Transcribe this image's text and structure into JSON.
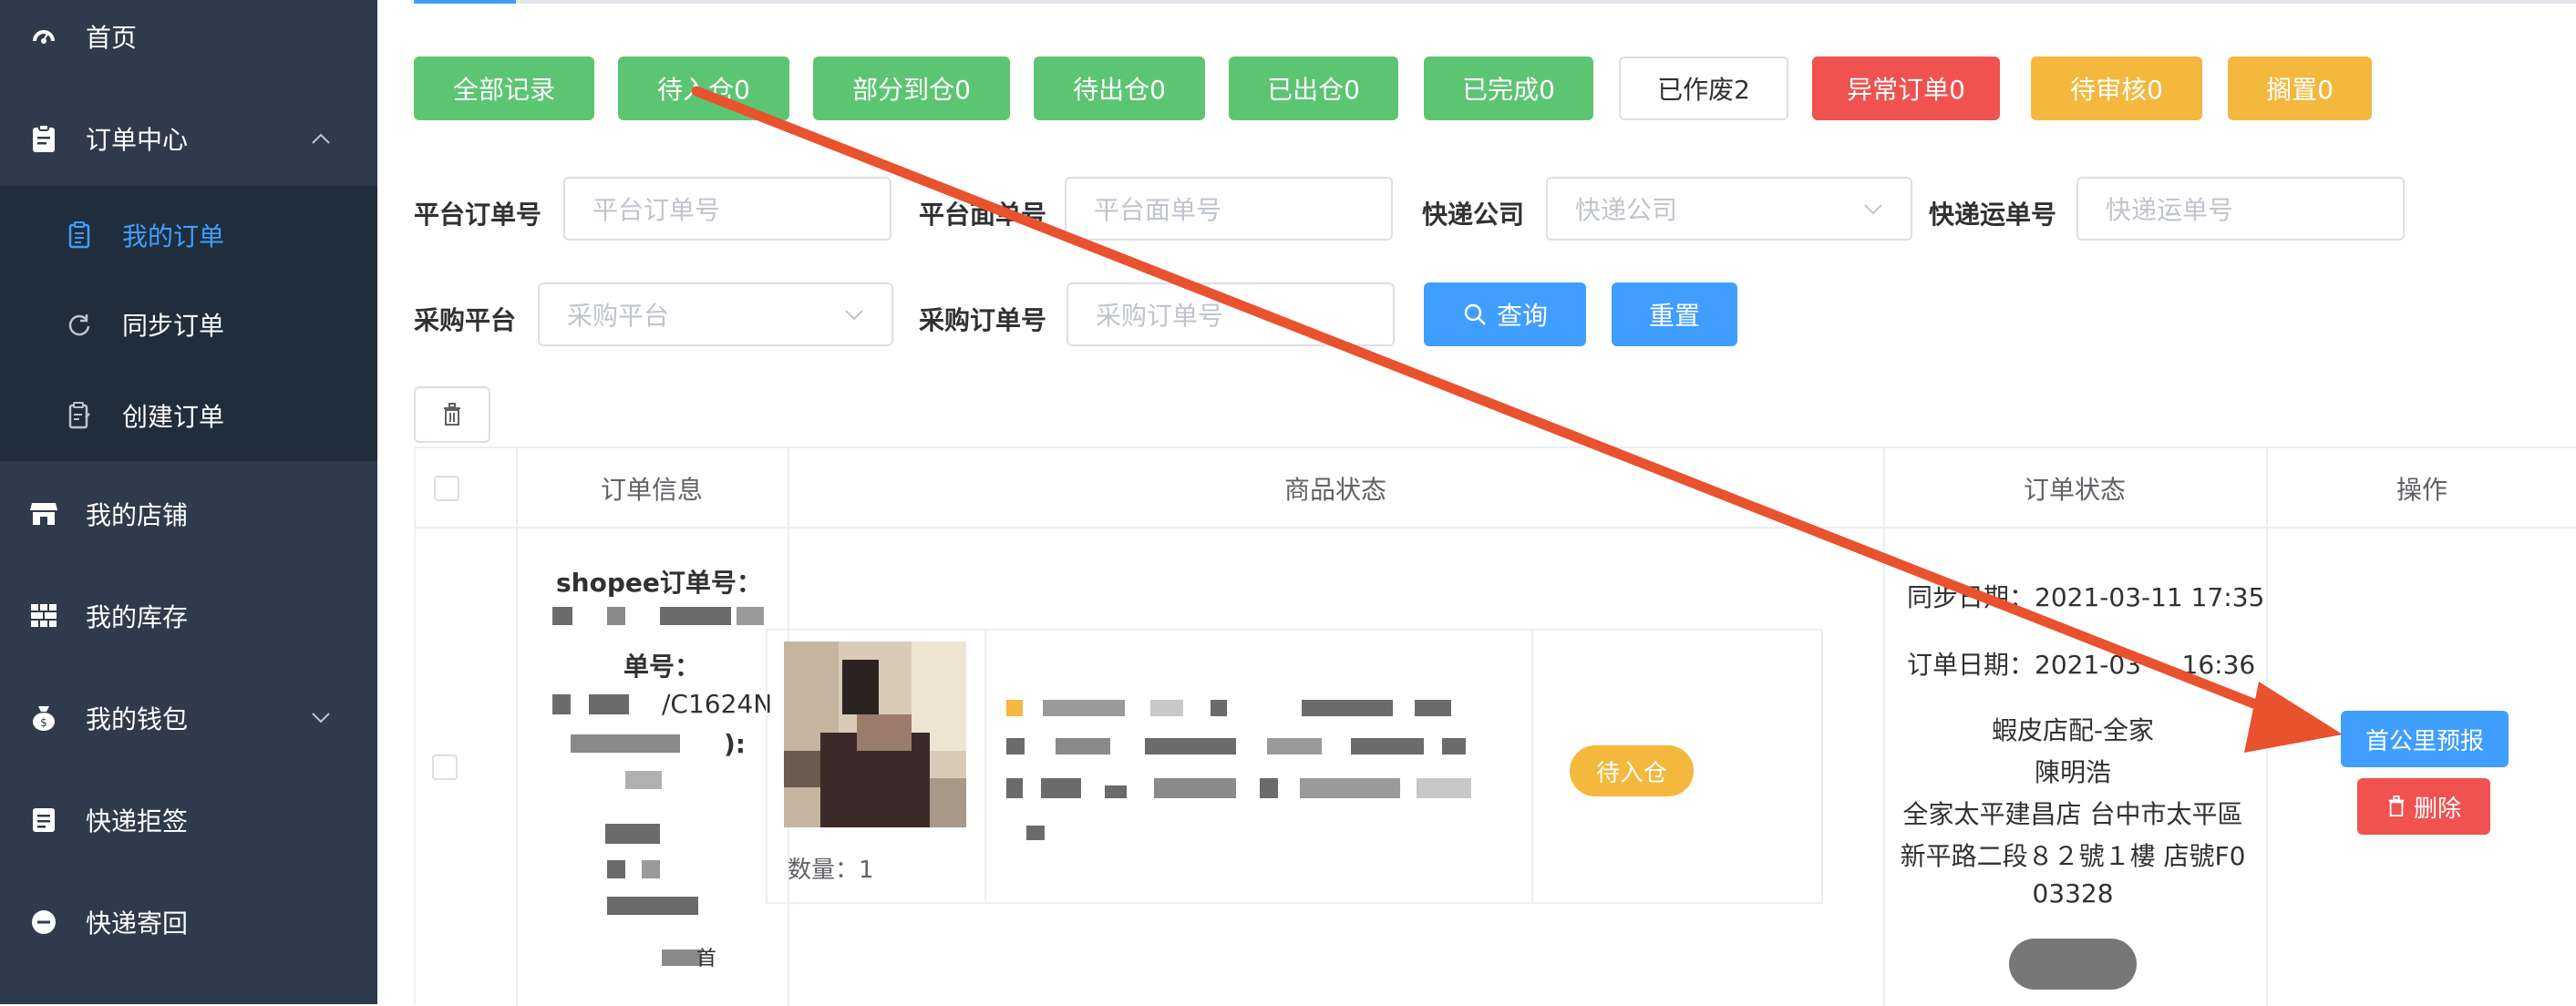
{
  "sidebar": {
    "items": [
      {
        "label": "首页",
        "icon": "dashboard-icon"
      },
      {
        "label": "订单中心",
        "icon": "clipboard-icon"
      },
      {
        "label": "我的店铺",
        "icon": "store-icon"
      },
      {
        "label": "我的库存",
        "icon": "inventory-icon"
      },
      {
        "label": "我的钱包",
        "icon": "wallet-icon"
      },
      {
        "label": "快递拒签",
        "icon": "reject-icon"
      },
      {
        "label": "快递寄回",
        "icon": "return-icon"
      }
    ],
    "sub_items": [
      {
        "label": "我的订单",
        "icon": "document-icon",
        "active": true
      },
      {
        "label": "同步订单",
        "icon": "sync-icon"
      },
      {
        "label": "创建订单",
        "icon": "create-icon"
      }
    ]
  },
  "filters": {
    "buttons": [
      {
        "label": "全部记录"
      },
      {
        "label": "待入仓0"
      },
      {
        "label": "部分到仓0"
      },
      {
        "label": "待出仓0"
      },
      {
        "label": "已出仓0"
      },
      {
        "label": "已完成0"
      },
      {
        "label": "已作废2"
      },
      {
        "label": "异常订单0"
      },
      {
        "label": "待审核0"
      },
      {
        "label": "搁置0"
      }
    ]
  },
  "search": {
    "platform_order_label": "平台订单号",
    "platform_order_placeholder": "平台订单号",
    "platform_sheet_label": "平台面单号",
    "platform_sheet_placeholder": "平台面单号",
    "courier_label": "快递公司",
    "courier_placeholder": "快递公司",
    "tracking_label": "快递运单号",
    "tracking_placeholder": "快递运单号",
    "purchase_platform_label": "采购平台",
    "purchase_platform_placeholder": "采购平台",
    "purchase_order_label": "采购订单号",
    "purchase_order_placeholder": "采购订单号",
    "query_label": "查询",
    "reset_label": "重置"
  },
  "table": {
    "headers": [
      "订单信息",
      "商品状态",
      "订单状态",
      "操作"
    ],
    "row": {
      "shopee_label": "shopee订单号：",
      "sheet_label": "单号：",
      "sheet_value_partial": "/C1624N",
      "paren_partial": "):",
      "qty_label": "数量：",
      "qty_value": "1",
      "goods_status": "待入仓",
      "sync_date_label": "同步日期：",
      "sync_date_value": "2021-03-11 17:35",
      "order_date_label": "订单日期：",
      "order_date_value_a": "2021-03",
      "order_date_value_b": "16:36",
      "shop_line": "蝦皮店配-全家",
      "name_line": "陳明浩",
      "addr_line1": "全家太平建昌店 台中市太平區",
      "addr_line2": "新平路二段８２號１樓 店號F0",
      "addr_line3": "03328",
      "predict_btn": "首公里预报",
      "delete_btn": "删除",
      "tail_partial": "首"
    }
  },
  "colors": {
    "sidebar_bg": "#2f3b4d",
    "submenu_bg": "#1f2d3d",
    "green": "#5cc573",
    "red": "#f0524f",
    "orange": "#f3b83d",
    "blue": "#409eff",
    "arrow": "#e8522e"
  }
}
